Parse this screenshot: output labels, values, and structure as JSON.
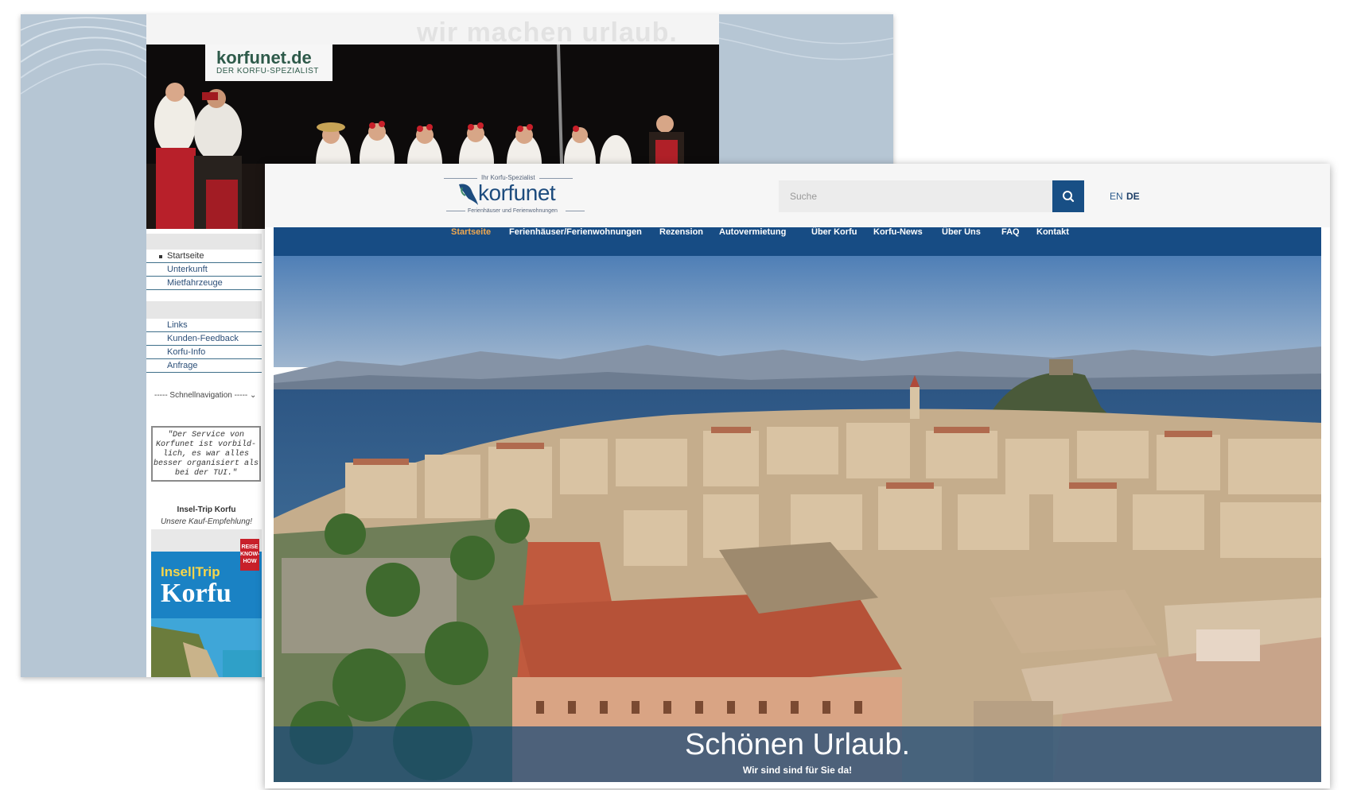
{
  "old_site": {
    "slogan": "wir machen urlaub.",
    "logo": "korfunet.de",
    "logo_sub": "DER KORFU-SPEZIALIST",
    "nav_group_1": [
      "Startseite",
      "Unterkunft",
      "Mietfahrzeuge"
    ],
    "nav_group_2": [
      "Links",
      "Kunden-Feedback",
      "Korfu-Info",
      "Anfrage"
    ],
    "quick_nav": "----- Schnellnavigation -----",
    "quote": "\"Der Service von Korfunet ist vorbild-lich, es war alles besser organisiert als bei der TUI.\"",
    "book_title": "Insel-Trip Korfu",
    "book_subtitle": "Unsere Kauf-Empfehlung!",
    "book_series": "Insel|Trip",
    "book_name": "Korfu",
    "book_badge": "REISE KNOW-HOW"
  },
  "new_site": {
    "tagline": "Ihr Korfu-Spezialist",
    "brand": "korfunet",
    "brand_sub": "Ferienhäuser und Ferienwohnungen",
    "search_placeholder": "Suche",
    "lang_en": "EN",
    "lang_de": "DE",
    "nav": [
      "Startseite",
      "Ferienhäuser/Ferienwohnungen",
      "Rezension",
      "Autovermietung",
      "Über Korfu",
      "Korfu-News",
      "Über Uns",
      "FAQ",
      "Kontakt"
    ],
    "hero_title": "Schönen Urlaub.",
    "hero_subtitle": "Wir sind sind für Sie da!"
  },
  "colors": {
    "brand_blue": "#174c84",
    "nav_active": "#f0a850",
    "old_link": "#2c4f78",
    "old_background": "#b6c6d4"
  }
}
